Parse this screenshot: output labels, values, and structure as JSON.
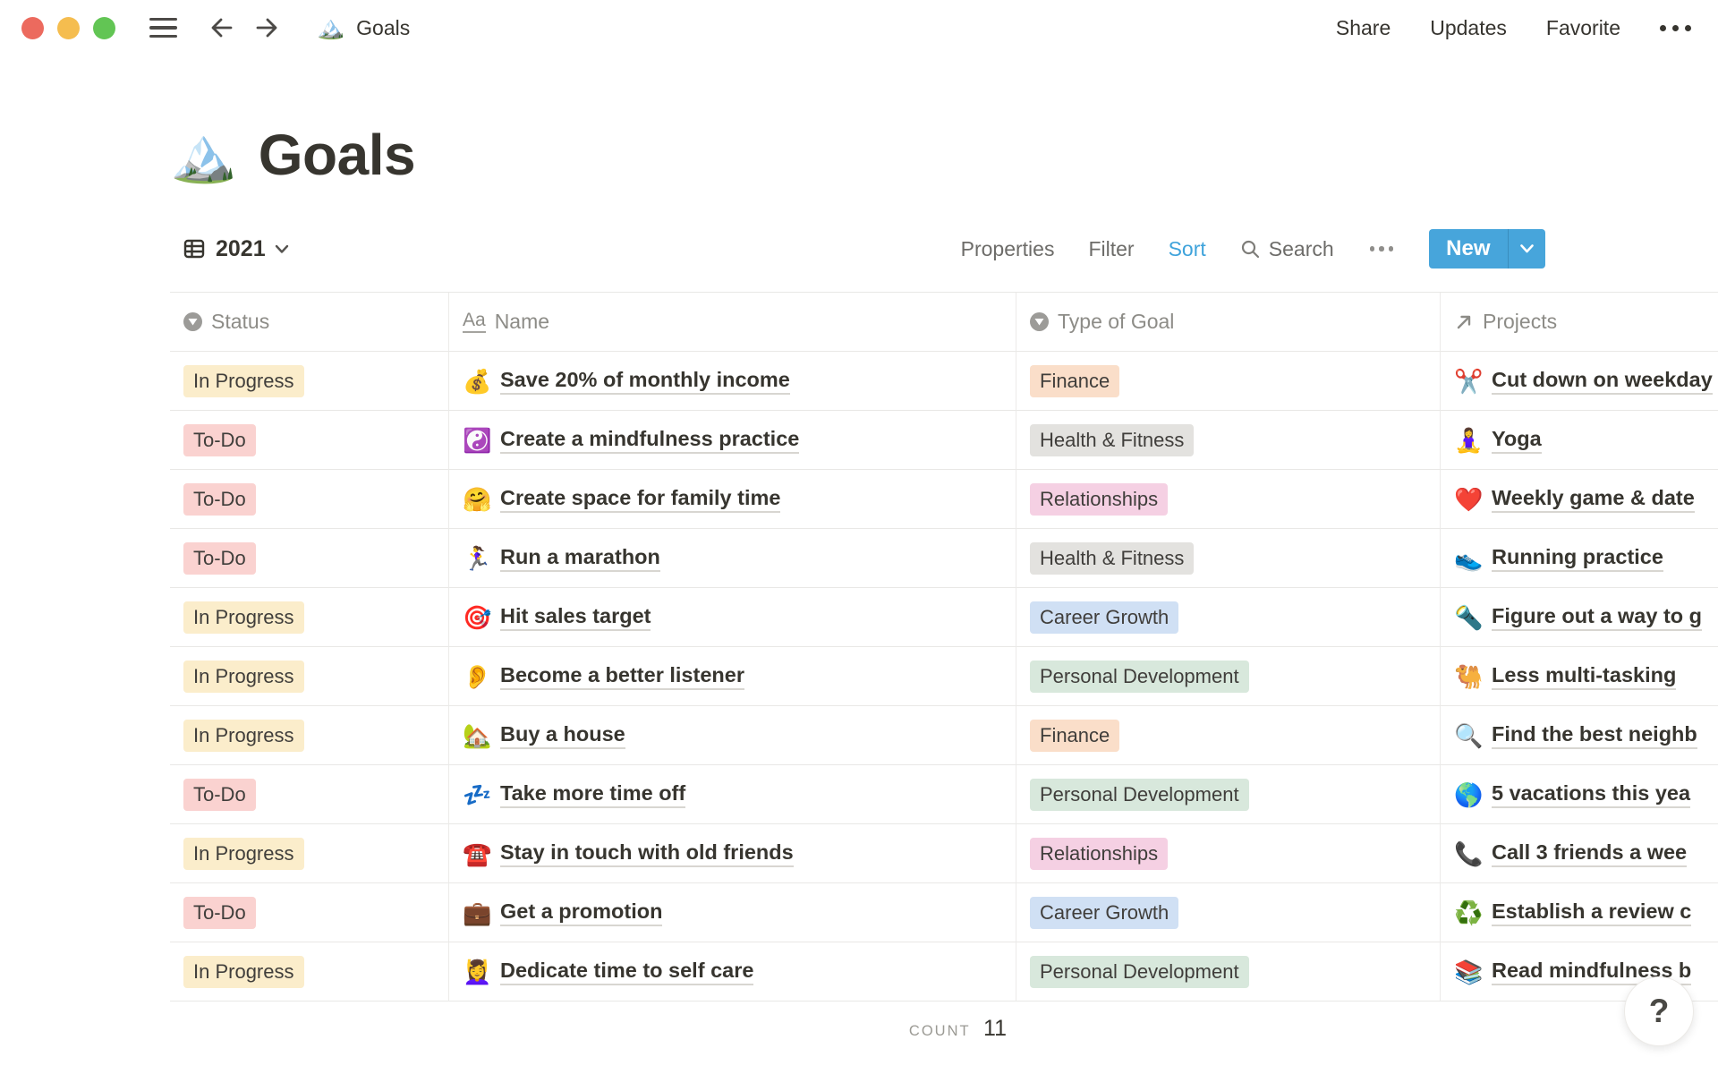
{
  "topbar": {
    "doc_icon": "🏔️",
    "doc_title": "Goals",
    "menu": [
      {
        "label": "Share"
      },
      {
        "label": "Updates"
      },
      {
        "label": "Favorite"
      }
    ]
  },
  "page": {
    "icon": "🏔️",
    "title": "Goals"
  },
  "toolbar": {
    "view_label": "2021",
    "properties_label": "Properties",
    "filter_label": "Filter",
    "sort_label": "Sort",
    "search_label": "Search",
    "new_label": "New"
  },
  "table": {
    "columns": [
      {
        "icon": "select-icon",
        "label": "Status"
      },
      {
        "icon": "text-icon",
        "label": "Name"
      },
      {
        "icon": "select-icon",
        "label": "Type of Goal"
      },
      {
        "icon": "relation-icon",
        "label": "Projects"
      }
    ],
    "rows": [
      {
        "status": "In Progress",
        "name_icon": "💰",
        "name": "Save 20% of monthly income",
        "type": "Finance",
        "project_icon": "✂️",
        "project": "Cut down on weekday"
      },
      {
        "status": "To-Do",
        "name_icon": "☯️",
        "name": "Create a mindfulness practice",
        "type": "Health & Fitness",
        "project_icon": "🧘‍♀️",
        "project": "Yoga"
      },
      {
        "status": "To-Do",
        "name_icon": "🤗",
        "name": "Create space for family time",
        "type": "Relationships",
        "project_icon": "❤️",
        "project": "Weekly game & date"
      },
      {
        "status": "To-Do",
        "name_icon": "🏃‍♀️",
        "name": "Run a marathon",
        "type": "Health & Fitness",
        "project_icon": "👟",
        "project": "Running practice"
      },
      {
        "status": "In Progress",
        "name_icon": "🎯",
        "name": "Hit sales target",
        "type": "Career Growth",
        "project_icon": "🔦",
        "project": "Figure out a way to g"
      },
      {
        "status": "In Progress",
        "name_icon": "👂",
        "name": "Become a better listener",
        "type": "Personal Development",
        "project_icon": "🐫",
        "project": "Less multi-tasking"
      },
      {
        "status": "In Progress",
        "name_icon": "🏡",
        "name": "Buy a house",
        "type": "Finance",
        "project_icon": "🔍",
        "project": "Find the best neighb"
      },
      {
        "status": "To-Do",
        "name_icon": "💤",
        "name": "Take more time off",
        "type": "Personal Development",
        "project_icon": "🌎",
        "project": "5 vacations this yea"
      },
      {
        "status": "In Progress",
        "name_icon": "☎️",
        "name": "Stay in touch with old friends",
        "type": "Relationships",
        "project_icon": "📞",
        "project": "Call 3 friends a wee"
      },
      {
        "status": "To-Do",
        "name_icon": "💼",
        "name": "Get a promotion",
        "type": "Career Growth",
        "project_icon": "♻️",
        "project": "Establish a review c"
      },
      {
        "status": "In Progress",
        "name_icon": "💆‍♀️",
        "name": "Dedicate time to self care",
        "type": "Personal Development",
        "project_icon": "📚",
        "project": "Read mindfulness b"
      }
    ]
  },
  "footer": {
    "count_label": "COUNT",
    "count_value": "11"
  },
  "help": {
    "label": "?"
  },
  "colors": {
    "accent_button": "#47A5DB",
    "sort_active": "#3FA3DB",
    "status": {
      "In Progress": "#FBEDCB",
      "To-Do": "#FAD2D0"
    },
    "type": {
      "Finance": "#FADEC9",
      "Health & Fitness": "#E3E2DF",
      "Relationships": "#F5D0E3",
      "Career Growth": "#D0E0F4",
      "Personal Development": "#D8E8DC"
    }
  }
}
